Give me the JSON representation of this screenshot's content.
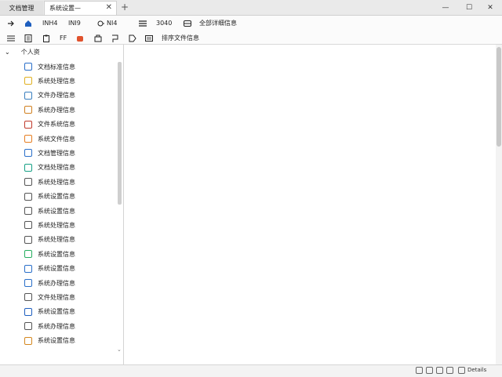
{
  "tabs": [
    {
      "label": "文档管理",
      "active": false
    },
    {
      "label": "系统设置—",
      "active": true
    }
  ],
  "window_controls": {
    "minimize": "—",
    "maximize": "☐",
    "close": "✕"
  },
  "toolbar1": {
    "items": [
      "INH4",
      "INI9",
      "NI4",
      "3040",
      "全部详细信息"
    ]
  },
  "toolbar2": {
    "items": [
      "FF",
      "排序文件信息"
    ]
  },
  "sidebar": {
    "header": "个人资",
    "items": [
      {
        "label": "文档标准信息",
        "icon": "document-blue-icon",
        "color": "#2a6fc9"
      },
      {
        "label": "系统处理信息",
        "icon": "clock-yellow-icon",
        "color": "#e0b020"
      },
      {
        "label": "文件办理信息",
        "icon": "notes-icon",
        "color": "#3a7fbf"
      },
      {
        "label": "系统办理信息",
        "icon": "image-file-icon",
        "color": "#d08020"
      },
      {
        "label": "文件系统信息",
        "icon": "record-red-icon",
        "color": "#c0392b"
      },
      {
        "label": "系统文件信息",
        "icon": "picture-orange-icon",
        "color": "#e67e22"
      },
      {
        "label": "文档管理信息",
        "icon": "user-blue-icon",
        "color": "#2a6fc9"
      },
      {
        "label": "文档处理信息",
        "icon": "chart-teal-icon",
        "color": "#16a085"
      },
      {
        "label": "系统处理信息",
        "icon": "headphone-icon",
        "color": "#555555"
      },
      {
        "label": "系统设置信息",
        "icon": "save-icon",
        "color": "#555555"
      },
      {
        "label": "系统设置信息",
        "icon": "folder-outline-icon",
        "color": "#555555"
      },
      {
        "label": "系统处理信息",
        "icon": "folder-outline-icon",
        "color": "#555555"
      },
      {
        "label": "系统处理信息",
        "icon": "refresh-icon",
        "color": "#555555"
      },
      {
        "label": "系统设置信息",
        "icon": "sheet-green-icon",
        "color": "#27ae60"
      },
      {
        "label": "系统设置信息",
        "icon": "cloud-icon",
        "color": "#2a6fc9"
      },
      {
        "label": "系统办理信息",
        "icon": "link-icon",
        "color": "#2a6fc9"
      },
      {
        "label": "文件处理信息",
        "icon": "grid-icon",
        "color": "#555555"
      },
      {
        "label": "系统设置信息",
        "icon": "video-blue-icon",
        "color": "#1f5fbf"
      },
      {
        "label": "系统办理信息",
        "icon": "page-icon",
        "color": "#555555"
      },
      {
        "label": "系统设置信息",
        "icon": "photo-orange-icon",
        "color": "#d4871e"
      }
    ]
  },
  "status": {
    "text": "Details"
  }
}
